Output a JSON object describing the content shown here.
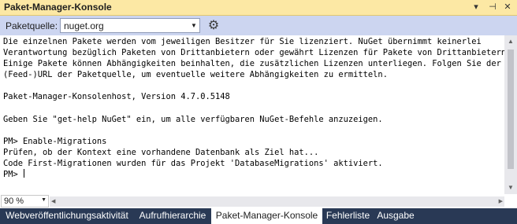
{
  "window": {
    "title": "Paket-Manager-Konsole",
    "dropdown_glyph": "▾",
    "pin_glyph": "⊣",
    "close_glyph": "✕"
  },
  "toolbar": {
    "source_label": "Paketquelle:",
    "source_value": "nuget.org",
    "combo_arrow": "▼",
    "settings_icon_glyph": "⚙"
  },
  "console": {
    "lines": [
      "Die einzelnen Pakete werden vom jeweiligen Besitzer für Sie lizenziert. NuGet übernimmt keinerlei",
      "Verantwortung bezüglich Paketen von Drittanbietern oder gewährt Lizenzen für Pakete von Drittanbietern.",
      "Einige Pakete können Abhängigkeiten beinhalten, die zusätzlichen Lizenzen unterliegen. Folgen Sie der",
      "(Feed-)URL der Paketquelle, um eventuelle weitere Abhängigkeiten zu ermitteln.",
      "",
      "Paket-Manager-Konsolenhost, Version 4.7.0.5148",
      "",
      "Geben Sie \"get-help NuGet\" ein, um alle verfügbaren NuGet-Befehle anzuzeigen.",
      "",
      "PM> Enable-Migrations",
      "Prüfen, ob der Kontext eine vorhandene Datenbank als Ziel hat...",
      "Code First-Migrationen wurden für das Projekt 'DatabaseMigrations' aktiviert."
    ],
    "prompt": "PM> "
  },
  "scroll": {
    "up_glyph": "▲",
    "down_glyph": "▼",
    "left_glyph": "◀",
    "right_glyph": "▶"
  },
  "zoom": {
    "value": "90 %",
    "arrow": "▼"
  },
  "tabs": [
    {
      "label": "Webveröffentlichungsaktivität"
    },
    {
      "label": "Aufrufhierarchie"
    },
    {
      "label": "Paket-Manager-Konsole"
    },
    {
      "label": "Fehlerliste"
    },
    {
      "label": "Ausgabe"
    }
  ],
  "colors": {
    "title_bar": "#fce8a4",
    "toolbar": "#ccd5f0",
    "tab_bar": "#293955",
    "active_tab": "#ffffff"
  }
}
